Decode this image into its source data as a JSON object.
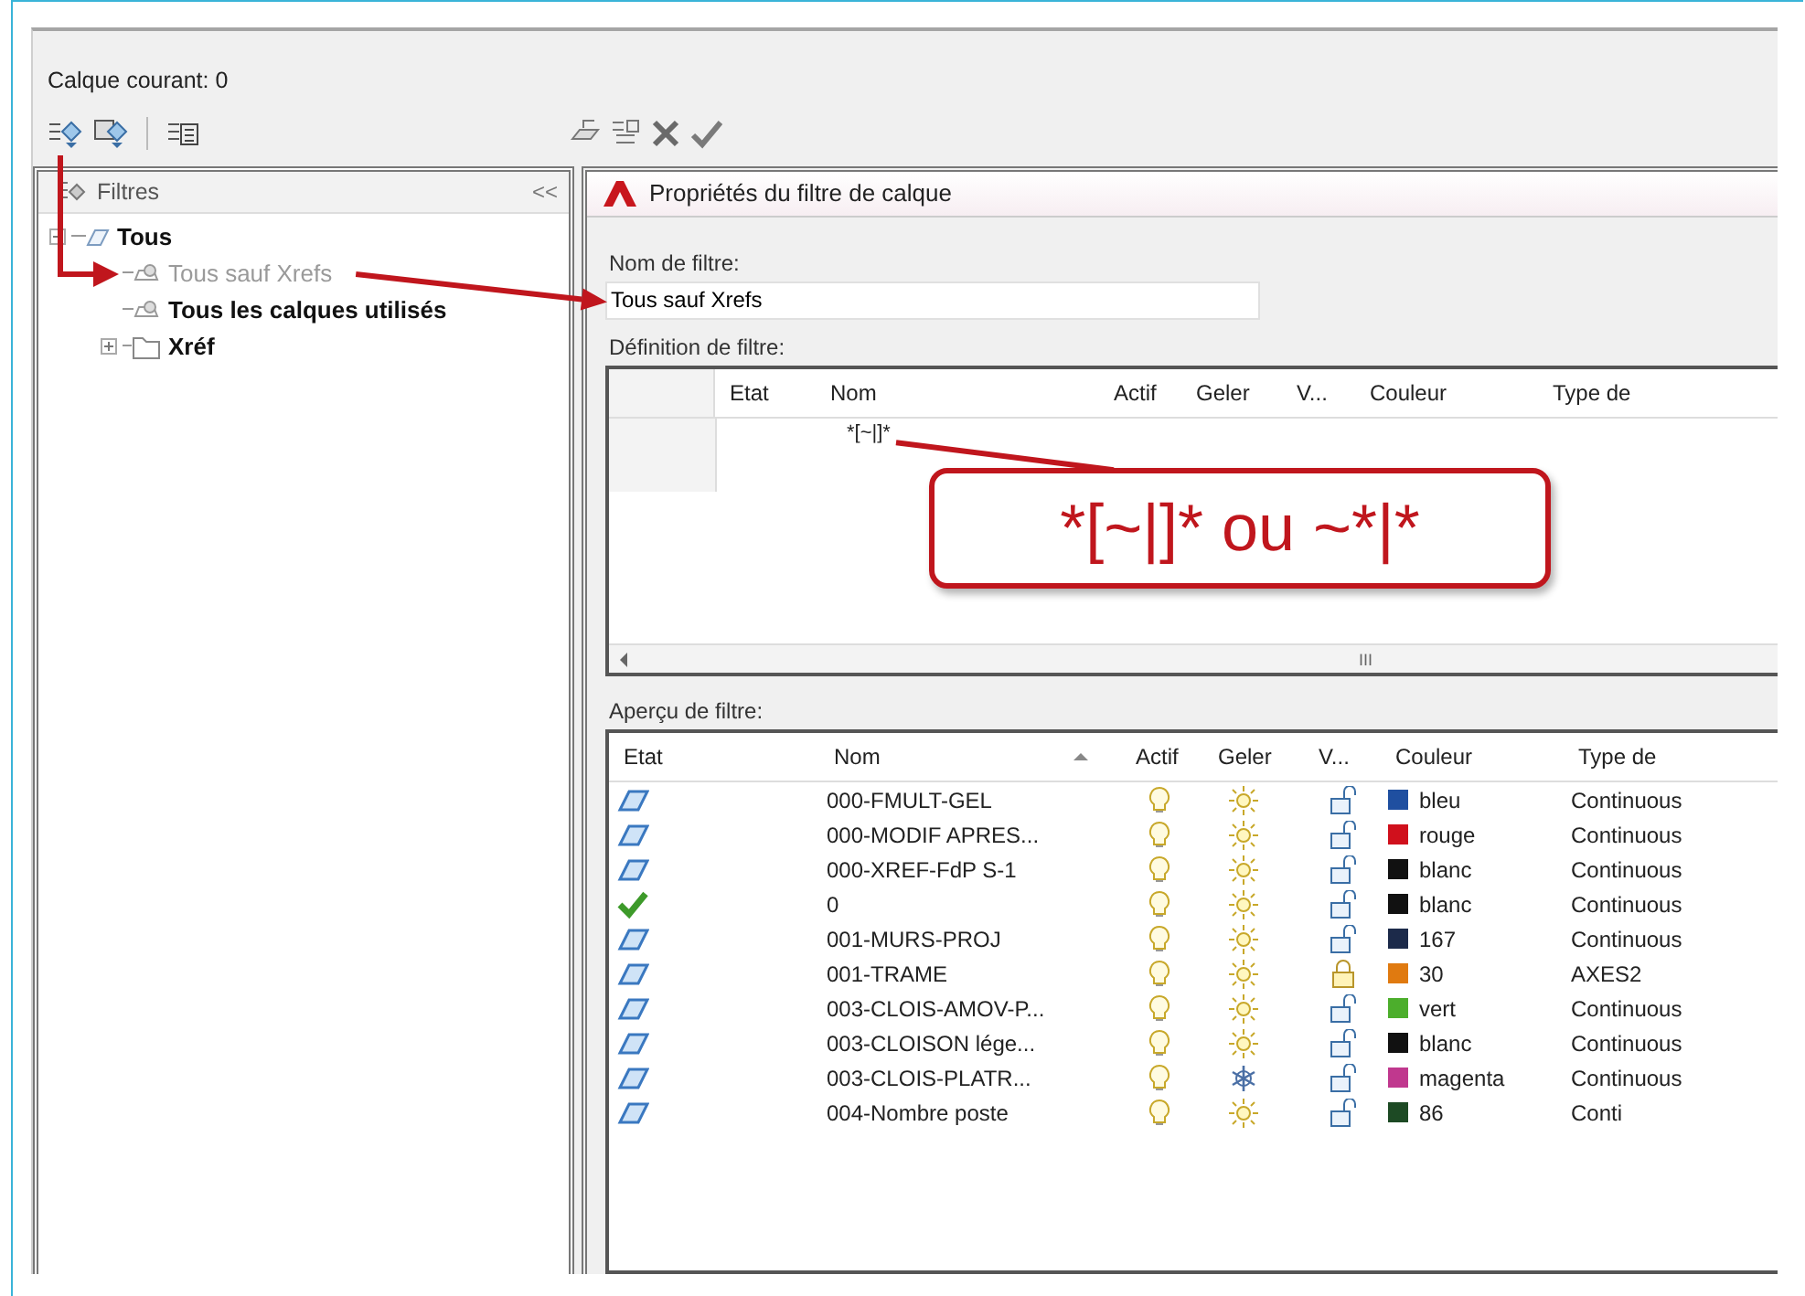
{
  "current_layer": "Calque courant: 0",
  "filters_panel": {
    "title": "Filtres",
    "collapse": "<<",
    "tree": [
      {
        "label": "Tous",
        "kind": "all",
        "expanded": true,
        "greyed": false,
        "children": [
          {
            "label": "Tous sauf Xrefs",
            "kind": "filter",
            "greyed": true
          },
          {
            "label": "Tous les calques utilisés",
            "kind": "filter",
            "greyed": false
          },
          {
            "label": "Xréf",
            "kind": "group",
            "expanded": false,
            "greyed": false
          }
        ]
      }
    ]
  },
  "dialog": {
    "title": "Propriétés du filtre de calque",
    "filter_name": {
      "label": "Nom de filtre:",
      "value": "Tous sauf Xrefs"
    },
    "definition": {
      "label": "Définition de filtre:",
      "columns": [
        "Etat",
        "Nom",
        "Actif",
        "Geler",
        "V...",
        "Couleur",
        "Type de"
      ],
      "rows": [
        {
          "name": "*[~|]*"
        }
      ],
      "scroll_mark": "III"
    },
    "callout": "*[~|]* ou ~*|*",
    "preview": {
      "label": "Aperçu de filtre:",
      "columns": [
        {
          "label": "Etat",
          "sorted": false
        },
        {
          "label": "Nom",
          "sorted": true
        },
        {
          "label": "Actif",
          "sorted": false
        },
        {
          "label": "Geler",
          "sorted": false
        },
        {
          "label": "V...",
          "sorted": false
        },
        {
          "label": "Couleur",
          "sorted": false
        },
        {
          "label": "Type de",
          "sorted": false
        }
      ],
      "rows": [
        {
          "kind": "layer",
          "name": "000-FMULT-GEL",
          "frozen": false,
          "locked": false,
          "color": "#1f4fa0",
          "color_name": "bleu",
          "linetype": "Continuous"
        },
        {
          "kind": "layer",
          "name": "000-MODIF APRES...",
          "frozen": false,
          "locked": false,
          "color": "#d0101c",
          "color_name": "rouge",
          "linetype": "Continuous"
        },
        {
          "kind": "layer",
          "name": "000-XREF-FdP S-1",
          "frozen": false,
          "locked": false,
          "color": "#111111",
          "color_name": "blanc",
          "linetype": "Continuous"
        },
        {
          "kind": "current",
          "name": "0",
          "frozen": false,
          "locked": false,
          "color": "#111111",
          "color_name": "blanc",
          "linetype": "Continuous"
        },
        {
          "kind": "layer",
          "name": "001-MURS-PROJ",
          "frozen": false,
          "locked": false,
          "color": "#1c2a4a",
          "color_name": "167",
          "linetype": "Continuous"
        },
        {
          "kind": "layer",
          "name": "001-TRAME",
          "frozen": false,
          "locked": true,
          "color": "#e07a10",
          "color_name": "30",
          "linetype": "AXES2"
        },
        {
          "kind": "layer",
          "name": "003-CLOIS-AMOV-P...",
          "frozen": false,
          "locked": false,
          "color": "#4cae2c",
          "color_name": "vert",
          "linetype": "Continuous"
        },
        {
          "kind": "layer",
          "name": "003-CLOISON lége...",
          "frozen": false,
          "locked": false,
          "color": "#111111",
          "color_name": "blanc",
          "linetype": "Continuous"
        },
        {
          "kind": "layer",
          "name": "003-CLOIS-PLATR...",
          "frozen": true,
          "locked": false,
          "color": "#c0388e",
          "color_name": "magenta",
          "linetype": "Continuous"
        },
        {
          "kind": "layer",
          "name": "004-Nombre poste",
          "frozen": false,
          "locked": false,
          "color": "#1d4a24",
          "color_name": "86",
          "linetype": "Conti"
        }
      ]
    }
  }
}
